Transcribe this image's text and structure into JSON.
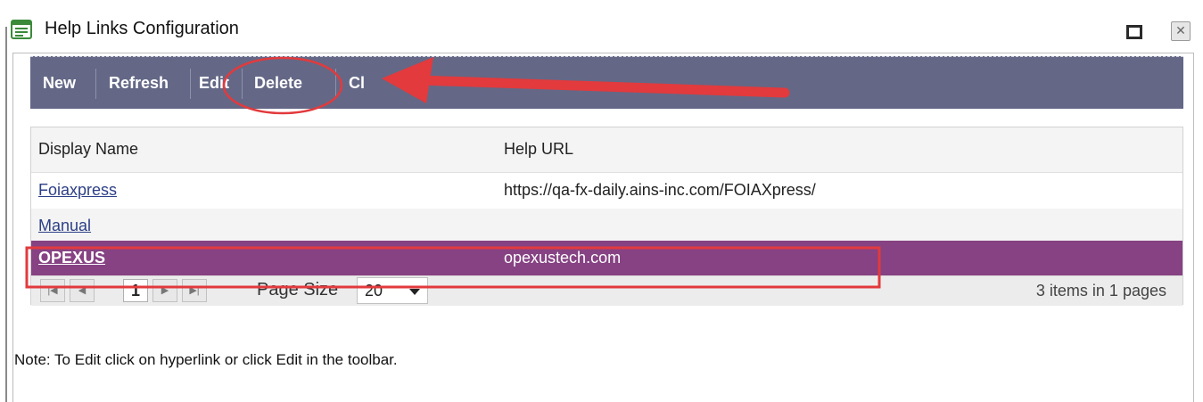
{
  "window": {
    "title": "Help Links Configuration"
  },
  "toolbar": {
    "new": "New",
    "refresh": "Refresh",
    "edit": "Edit",
    "delete": "Delete",
    "close": "Cl"
  },
  "grid": {
    "columns": [
      "Display Name",
      "Help URL"
    ],
    "rows": [
      {
        "name": "Foiaxpress",
        "url": "https://qa-fx-daily.ains-inc.com/FOIAXpress/"
      },
      {
        "name": "Manual",
        "url": ""
      },
      {
        "name": "OPEXUS",
        "url": "opexustech.com"
      }
    ],
    "selected_row": 2
  },
  "pager": {
    "current_page": "1",
    "page_size_label": "Page Size",
    "page_size_value": "20",
    "items_info": "3 items in 1 pages"
  },
  "note": "Note: To Edit click on hyperlink or click Edit in the toolbar.",
  "colors": {
    "toolbar": "#646886",
    "selected_row": "#864283",
    "annotation": "#e23a3d",
    "link": "#2d3f86"
  }
}
